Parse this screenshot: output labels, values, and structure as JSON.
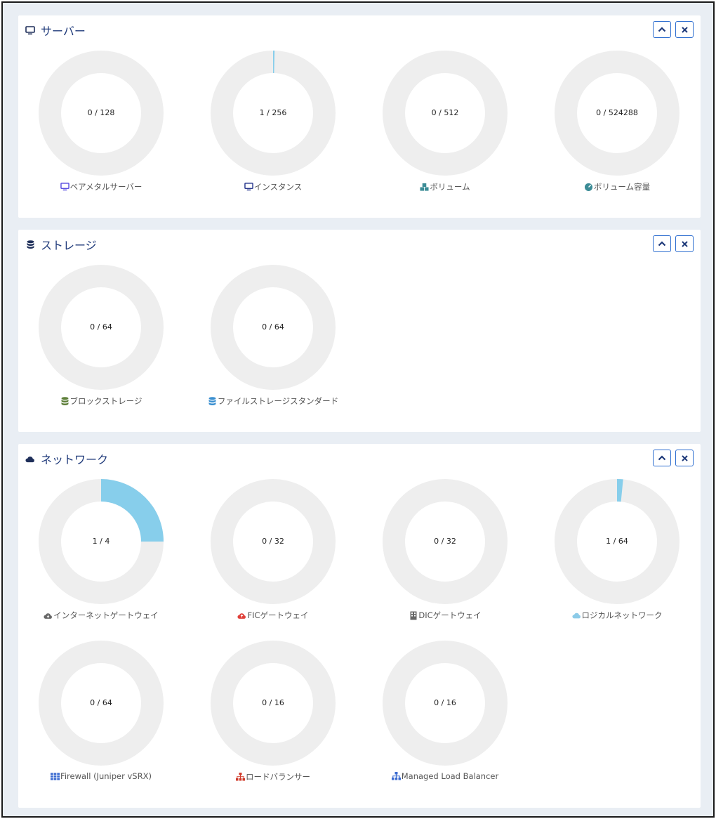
{
  "panels": [
    {
      "title": "サーバー",
      "icon": "monitor-icon",
      "items": [
        {
          "label": "ベアメタルサーバー",
          "used": 0,
          "total": 128,
          "value_text": "0 / 128",
          "icon": "monitor-icon",
          "icon_color": "#5b4fe0"
        },
        {
          "label": "インスタンス",
          "used": 1,
          "total": 256,
          "value_text": "1 / 256",
          "icon": "monitor-icon",
          "icon_color": "#2b3a8f"
        },
        {
          "label": "ボリューム",
          "used": 0,
          "total": 512,
          "value_text": "0 / 512",
          "icon": "cubes-icon",
          "icon_color": "#3c8c96"
        },
        {
          "label": "ボリューム容量",
          "used": 0,
          "total": 524288,
          "value_text": "0 / 524288",
          "icon": "gauge-icon",
          "icon_color": "#3c8c96"
        }
      ]
    },
    {
      "title": "ストレージ",
      "icon": "database-icon",
      "items": [
        {
          "label": "ブロックストレージ",
          "used": 0,
          "total": 64,
          "value_text": "0 / 64",
          "icon": "database-icon",
          "icon_color": "#5e7f3a"
        },
        {
          "label": "ファイルストレージスタンダード",
          "used": 0,
          "total": 64,
          "value_text": "0 / 64",
          "icon": "database-icon",
          "icon_color": "#3a8fd0"
        }
      ]
    },
    {
      "title": "ネットワーク",
      "icon": "cloud-icon",
      "items": [
        {
          "label": "インターネットゲートウェイ",
          "used": 1,
          "total": 4,
          "value_text": "1 / 4",
          "icon": "cloud-download-icon",
          "icon_color": "#666666"
        },
        {
          "label": "FICゲートウェイ",
          "used": 0,
          "total": 32,
          "value_text": "0 / 32",
          "icon": "cloud-upload-icon",
          "icon_color": "#e0403a"
        },
        {
          "label": "DICゲートウェイ",
          "used": 0,
          "total": 32,
          "value_text": "0 / 32",
          "icon": "building-icon",
          "icon_color": "#666666"
        },
        {
          "label": "ロジカルネットワーク",
          "used": 1,
          "total": 64,
          "value_text": "1 / 64",
          "icon": "cloud-icon",
          "icon_color": "#8ccbe8"
        },
        {
          "label": "Firewall (Juniper vSRX)",
          "used": 0,
          "total": 64,
          "value_text": "0 / 64",
          "icon": "firewall-icon",
          "icon_color": "#3a6ad0"
        },
        {
          "label": "ロードバランサー",
          "used": 0,
          "total": 16,
          "value_text": "0 / 16",
          "icon": "sitemap-icon",
          "icon_color": "#d03a2a"
        },
        {
          "label": "Managed Load Balancer",
          "used": 0,
          "total": 16,
          "value_text": "0 / 16",
          "icon": "sitemap-icon",
          "icon_color": "#3a6ad0"
        }
      ]
    }
  ],
  "colors": {
    "donut_track": "#eeeeee",
    "donut_fill": "#87ceeb",
    "title": "#1f3a7a",
    "button_border": "#2f6fd0"
  }
}
